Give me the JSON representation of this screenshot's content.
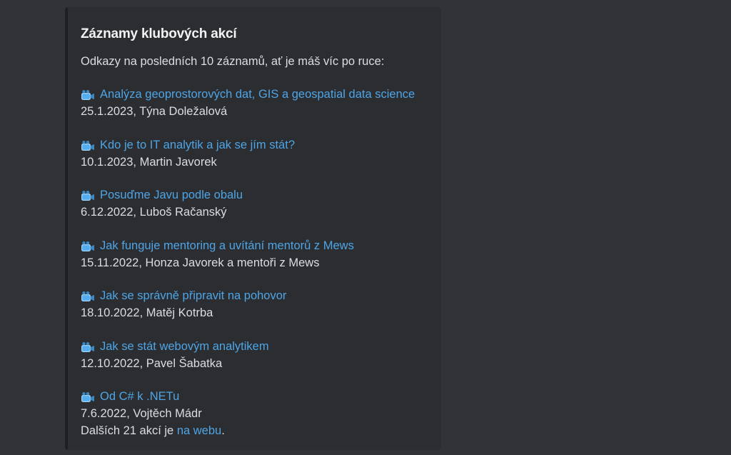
{
  "embed": {
    "title": "Záznamy klubových akcí",
    "intro": "Odkazy na posledních 10 záznamů, ať je máš víc po ruce:",
    "icon": "video-camera-icon",
    "link_color": "#4ea5e6",
    "entries": [
      {
        "link": "Analýza geoprostorových dat, GIS a geospatial data science",
        "meta": "25.1.2023, Týna Doležalová"
      },
      {
        "link": "Kdo je to IT analytik a jak se jím stát?",
        "meta": "10.1.2023, Martin Javorek"
      },
      {
        "link": "Posuďme Javu podle obalu",
        "meta": "6.12.2022, Luboš Račanský"
      },
      {
        "link": "Jak funguje mentoring a uvítání mentorů z Mews",
        "meta": "15.11.2022, Honza Javorek a mentoři z Mews"
      },
      {
        "link": "Jak se správně připravit na pohovor",
        "meta": "18.10.2022, Matěj Kotrba"
      },
      {
        "link": "Jak se stát webovým analytikem",
        "meta": "12.10.2022, Pavel Šabatka"
      },
      {
        "link": "Od C# k .NETu",
        "meta": "7.6.2022, Vojtěch Mádr"
      }
    ],
    "footer": {
      "prefix": "Dalších 21 akcí je ",
      "link": "na webu",
      "suffix": "."
    }
  }
}
